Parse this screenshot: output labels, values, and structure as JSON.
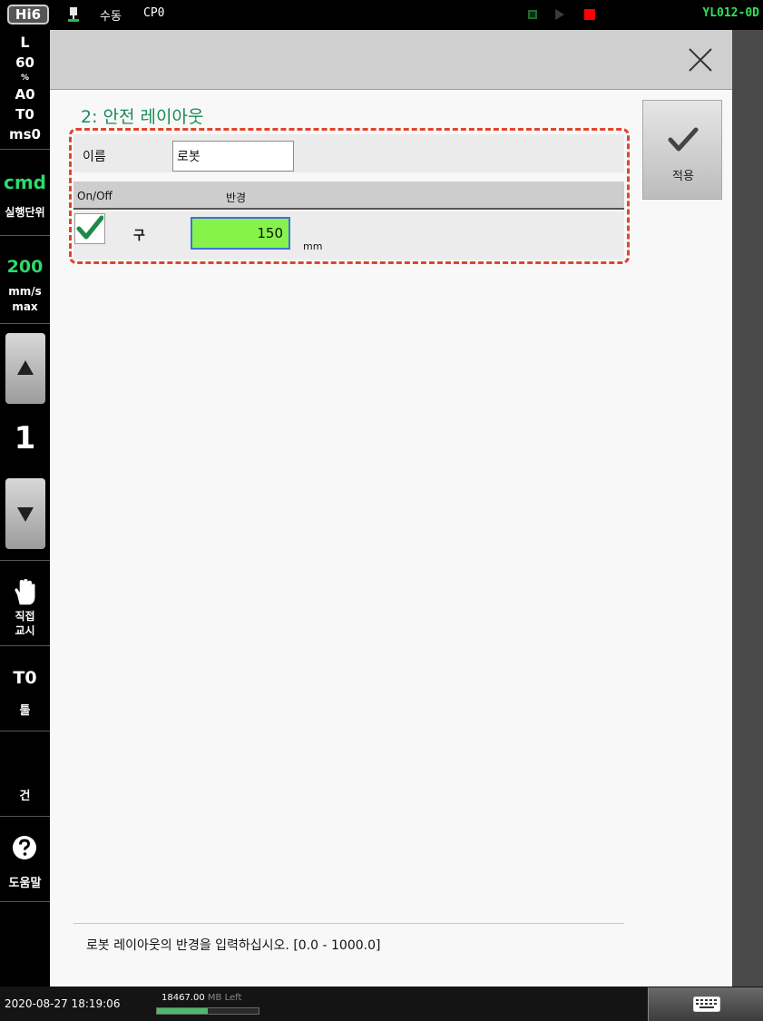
{
  "topbar": {
    "badge": "Hi6",
    "mode": "수동",
    "cp": "CP0",
    "robot_id": "YL012-0D",
    "icons": [
      "connection-icon",
      "run-indicator-icon",
      "play-indicator-icon",
      "stop-indicator-icon"
    ],
    "colors": {
      "robot_id": "#2fe05a",
      "stop": "#ff0000"
    }
  },
  "leftbar": {
    "speed_mode": "L",
    "override_value": "60",
    "override_unit": "%",
    "accuracy": "A0",
    "tool_short": "T0",
    "ms": "ms0",
    "cmd_label": "cmd",
    "exec_unit_label": "실행단위",
    "speed_value": "200",
    "speed_unit": "mm/s",
    "speed_max": "max",
    "step_number": "1",
    "direct_teach_line1": "직접",
    "direct_teach_line2": "교시",
    "tool_value": "T0",
    "tool_label": "툴",
    "gun_label": "건",
    "help_label": "도움말",
    "colors": {
      "cmd": "#2fd86a",
      "speed": "#2fd86a"
    }
  },
  "main": {
    "title": "2: 안전 레이아웃",
    "apply_label": "적용",
    "name_label": "이름",
    "name_value": "로봇",
    "col_onoff": "On/Off",
    "col_radius": "반경",
    "row": {
      "enabled": true,
      "shape": "구",
      "radius": "150",
      "unit": "mm"
    },
    "hint": "로봇 레이아웃의 반경을 입력하십시오. [0.0 - 1000.0]",
    "colors": {
      "title": "#1a8a5a",
      "radius_bg": "#86f24a",
      "group_border": "#e0452f"
    }
  },
  "bottombar": {
    "datetime": "2020-08-27 18:19:06",
    "memory_value": "18467.00",
    "memory_unit": "MB Left",
    "memory_usage_fraction": 0.5
  }
}
